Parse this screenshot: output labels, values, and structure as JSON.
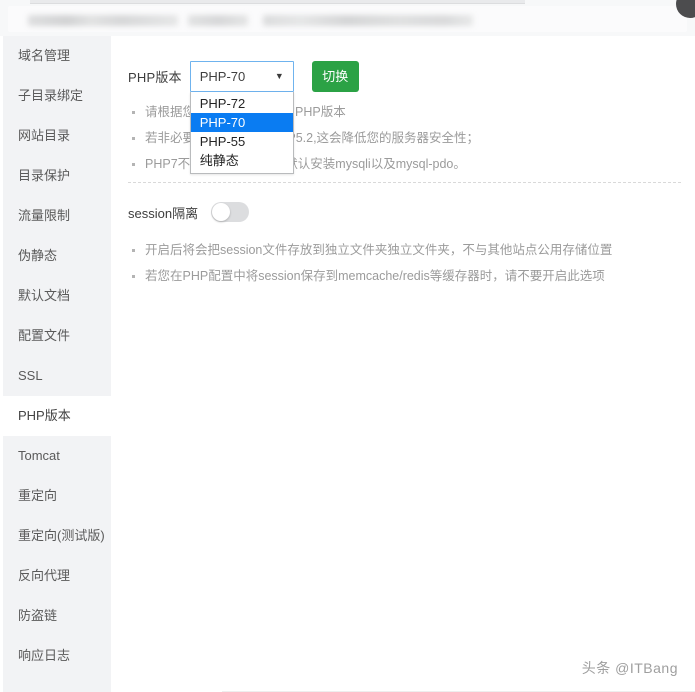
{
  "window": {
    "title": "PHP版本"
  },
  "header": {
    "blurred": true,
    "bars": [
      "",
      "",
      ""
    ]
  },
  "sidebar": {
    "items": [
      {
        "label": "域名管理",
        "active": false
      },
      {
        "label": "子目录绑定",
        "active": false
      },
      {
        "label": "网站目录",
        "active": false
      },
      {
        "label": "目录保护",
        "active": false
      },
      {
        "label": "流量限制",
        "active": false
      },
      {
        "label": "伪静态",
        "active": false
      },
      {
        "label": "默认文档",
        "active": false
      },
      {
        "label": "配置文件",
        "active": false
      },
      {
        "label": "SSL",
        "active": false
      },
      {
        "label": "PHP版本",
        "active": true
      },
      {
        "label": "Tomcat",
        "active": false
      },
      {
        "label": "重定向",
        "active": false
      },
      {
        "label": "重定向(测试版)",
        "active": false
      },
      {
        "label": "反向代理",
        "active": false
      },
      {
        "label": "防盗链",
        "active": false
      },
      {
        "label": "响应日志",
        "active": false
      }
    ]
  },
  "php_section": {
    "label": "PHP版本",
    "selected_value": "PHP-70",
    "caret": "▼",
    "dropdown_open": true,
    "options": [
      {
        "label": "PHP-72",
        "selected": false
      },
      {
        "label": "PHP-70",
        "selected": true
      },
      {
        "label": "PHP-55",
        "selected": false
      },
      {
        "label": "纯静态",
        "selected": false
      }
    ],
    "switch_button_label": "切换",
    "tips": [
      "请根据您的程序选择合适的PHP版本",
      "若非必要，请不要选择PHP5.2,这会降低您的服务器安全性；",
      "PHP7不支持mysql扩展，默认安装mysqli以及mysql-pdo。"
    ]
  },
  "session_section": {
    "label": "session隔离",
    "toggle_on": false,
    "tips": [
      "开启后将会把session文件存放到独立文件夹独立文件夹，不与其他站点公用存储位置",
      "若您在PHP配置中将session保存到memcache/redis等缓存器时，请不要开启此选项"
    ]
  },
  "watermark": {
    "text": "头条 @ITBang"
  },
  "colors": {
    "accent_green": "#2ba245",
    "highlight_blue": "#0a7cf2",
    "focus_border": "#6fb3ee",
    "sidebar_bg": "#f2f3f5"
  }
}
